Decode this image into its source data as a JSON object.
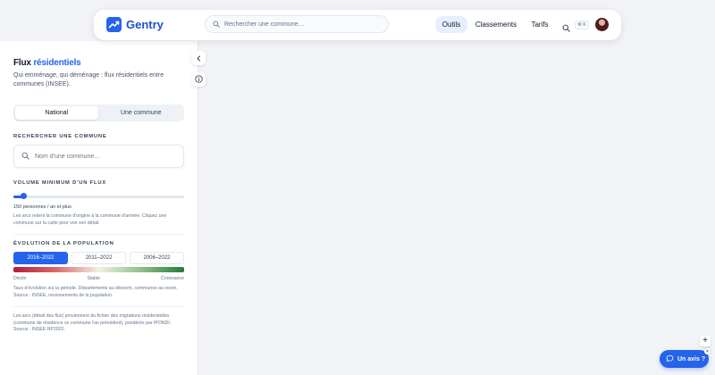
{
  "app": {
    "name": "Gentry",
    "accent": "#2563eb"
  },
  "navbar": {
    "search_placeholder": "Rechercher une commune…",
    "items": [
      {
        "label": "Outils",
        "active": true
      },
      {
        "label": "Classements",
        "active": false
      },
      {
        "label": "Tarifs",
        "active": false
      }
    ],
    "shortcut": "⌘ K"
  },
  "panel": {
    "title_part1": "Flux",
    "title_part2": "résidentiels",
    "description": "Qui emménage, qui déménage : flux résidentiels entre communes (INSEE).",
    "scope_tabs": [
      {
        "label": "National",
        "active": true
      },
      {
        "label": "Une commune",
        "active": false
      }
    ],
    "search_section_label": "RECHERCHER UNE COMMUNE",
    "search_placeholder": "Nom d'une commune…",
    "volume_section_label": "VOLUME MINIMUM D'UN FLUX",
    "volume_value": 0.06,
    "volume_text": "150 personnes / an et plus",
    "volume_hint": "Les arcs relient la commune d'origine à la commune d'arrivée. Cliquez une commune sur la carte pour voir son détail.",
    "evolution_section_label": "ÉVOLUTION DE LA POPULATION",
    "periods": [
      {
        "label": "2016–2022",
        "active": true
      },
      {
        "label": "2011–2022",
        "active": false
      },
      {
        "label": "2006–2022",
        "active": false
      }
    ],
    "gradient_labels": {
      "left": "Déclin",
      "center": "Stable",
      "right": "Croissance"
    },
    "evolution_hint": "Taux d'évolution sur la période. Départements au dézoom, communes au zoom. Source : INSEE, recensements de la population.",
    "footer_note": "Les arcs (détail des flux) proviennent du fichier des migrations résidentielles (commune de résidence vs commune l'an précédent), pondérés par IPONDI. Source : INSEE RP2022."
  },
  "feedback": {
    "label": "Un avis ?"
  },
  "icons": {
    "logo": "trend-chart-icon",
    "search": "search-icon",
    "collapse": "chevron-left-icon",
    "info": "info-icon",
    "zoom_in": "plus-icon",
    "chat": "chat-bubble-icon",
    "close": "close-icon"
  }
}
